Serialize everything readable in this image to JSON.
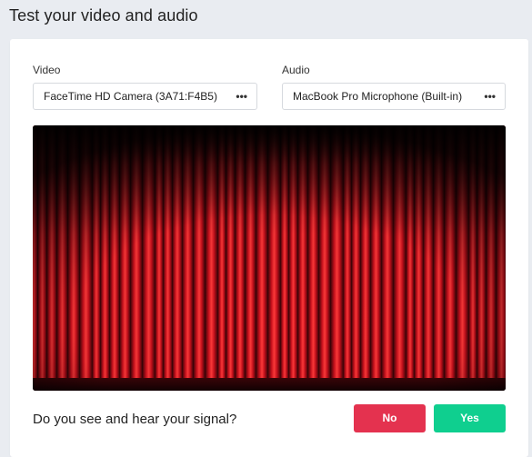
{
  "header": {
    "title": "Test your video and audio"
  },
  "video": {
    "label": "Video",
    "selected": "FaceTime HD Camera (3A71:F4B5)",
    "more_icon": "ellipsis-icon"
  },
  "audio": {
    "label": "Audio",
    "selected": "MacBook Pro Microphone (Built-in)",
    "more_icon": "ellipsis-icon"
  },
  "preview": {
    "scene": "red stage curtain",
    "colors": {
      "curtain": "#c8101c",
      "shadow": "#2a0205",
      "highlight": "#ff3a3a"
    }
  },
  "prompt": {
    "question": "Do you see and hear your signal?",
    "no_label": "No",
    "yes_label": "Yes"
  },
  "colors": {
    "no": "#e4324f",
    "yes": "#0fcf8f",
    "background": "#e9ecf1"
  }
}
